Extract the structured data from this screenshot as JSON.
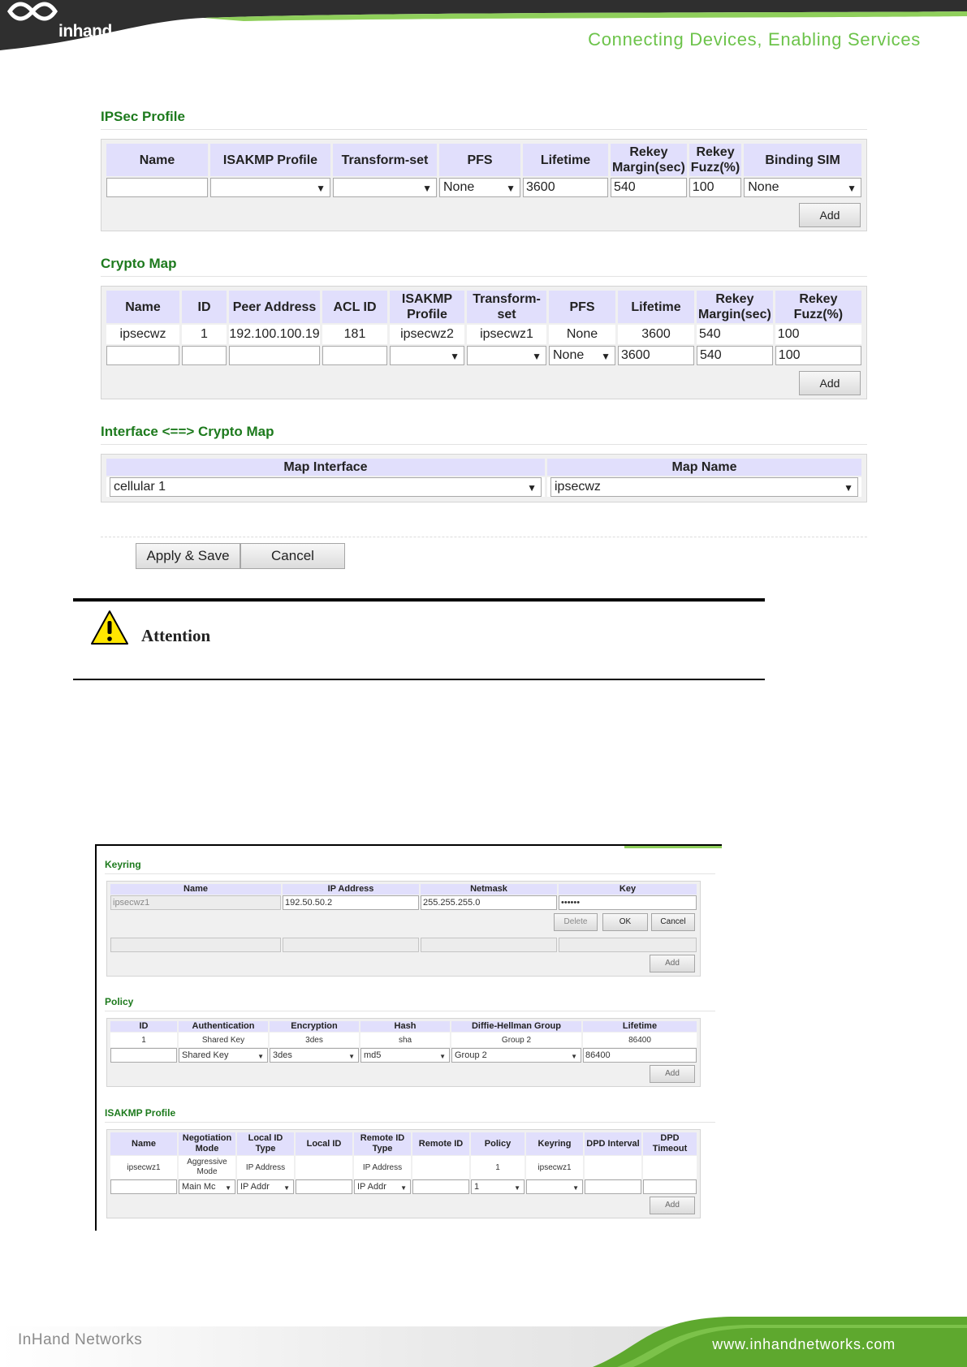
{
  "header": {
    "logo_text": "inhand",
    "tagline": "Connecting Devices, Enabling Services"
  },
  "ipsec_profile": {
    "title": "IPSec Profile",
    "columns": [
      "Name",
      "ISAKMP Profile",
      "Transform-set",
      "PFS",
      "Lifetime",
      "Rekey Margin(sec)",
      "Rekey Fuzz(%)",
      "Binding SIM"
    ],
    "new_row": {
      "name": "",
      "isakmp_profile": "",
      "transform_set": "",
      "pfs": "None",
      "lifetime": "3600",
      "rekey_margin": "540",
      "rekey_fuzz": "100",
      "binding_sim": "None"
    },
    "add_label": "Add"
  },
  "crypto_map": {
    "title": "Crypto Map",
    "columns": [
      "Name",
      "ID",
      "Peer Address",
      "ACL ID",
      "ISAKMP Profile",
      "Transform-set",
      "PFS",
      "Lifetime",
      "Rekey Margin(sec)",
      "Rekey Fuzz(%)"
    ],
    "rows": [
      [
        "ipsecwz",
        "1",
        "192.100.100.19",
        "181",
        "ipsecwz2",
        "ipsecwz1",
        "None",
        "3600",
        "540",
        "100"
      ]
    ],
    "new_row": {
      "name": "",
      "id": "",
      "peer_address": "",
      "acl_id": "",
      "isakmp_profile": "",
      "transform_set": "",
      "pfs": "None",
      "lifetime": "3600",
      "rekey_margin": "540",
      "rekey_fuzz": "100"
    },
    "add_label": "Add"
  },
  "interface_map": {
    "title": "Interface <==> Crypto Map",
    "columns": [
      "Map Interface",
      "Map Name"
    ],
    "map_interface": "cellular 1",
    "map_name": "ipsecwz"
  },
  "actions": {
    "apply_label": "Apply & Save",
    "cancel_label": "Cancel"
  },
  "attention": {
    "label": "Attention"
  },
  "keyring": {
    "title": "Keyring",
    "columns": [
      "Name",
      "IP Address",
      "Netmask",
      "Key"
    ],
    "edit_row": {
      "name": "ipsecwz1",
      "ip_address": "192.50.50.2",
      "netmask": "255.255.255.0",
      "key": "••••••"
    },
    "delete_label": "Delete",
    "ok_label": "OK",
    "cancel_label": "Cancel",
    "add_label": "Add"
  },
  "policy": {
    "title": "Policy",
    "columns": [
      "ID",
      "Authentication",
      "Encryption",
      "Hash",
      "Diffie-Hellman Group",
      "Lifetime"
    ],
    "rows": [
      [
        "1",
        "Shared Key",
        "3des",
        "sha",
        "Group 2",
        "86400"
      ]
    ],
    "new_row": {
      "id": "",
      "authentication": "Shared Key",
      "encryption": "3des",
      "hash": "md5",
      "dh_group": "Group 2",
      "lifetime": "86400"
    },
    "add_label": "Add"
  },
  "isakmp_profile": {
    "title": "ISAKMP Profile",
    "columns": [
      "Name",
      "Negotiation Mode",
      "Local ID Type",
      "Local ID",
      "Remote ID Type",
      "Remote ID",
      "Policy",
      "Keyring",
      "DPD Interval",
      "DPD Timeout"
    ],
    "rows": [
      [
        "ipsecwz1",
        "Aggressive Mode",
        "IP Address",
        "",
        "IP Address",
        "",
        "1",
        "ipsecwz1",
        "",
        ""
      ]
    ],
    "new_row": {
      "name": "",
      "negotiation_mode": "Main Mc",
      "local_id_type": "IP Addr",
      "local_id": "",
      "remote_id_type": "IP Addr",
      "remote_id": "",
      "policy": "1",
      "keyring": "",
      "dpd_interval": "",
      "dpd_timeout": ""
    },
    "add_label": "Add"
  },
  "footer": {
    "brand": "InHand Networks",
    "url": "www.inhandnetworks.com"
  },
  "colors": {
    "section_title": "#1d7a1d",
    "header_bg": "#2f2f2f",
    "header_green": "#8fcf5b",
    "tagline": "#6cc34a",
    "table_header": "#e1dffc",
    "footer_green": "#5ea82e"
  }
}
